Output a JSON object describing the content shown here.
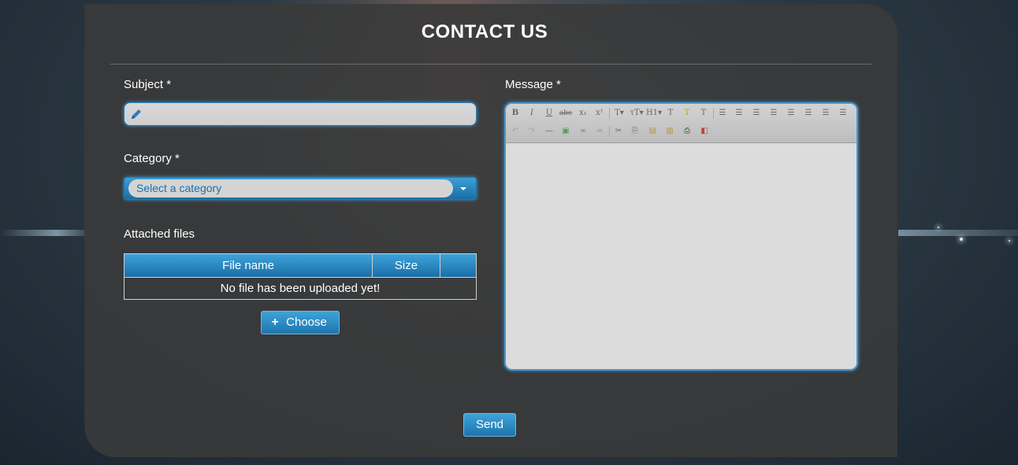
{
  "page": {
    "title": "CONTACT US"
  },
  "form": {
    "subject": {
      "label": "Subject *",
      "value": "",
      "icon": "pencil-icon"
    },
    "category": {
      "label": "Category *",
      "selected": "Select a category"
    },
    "attached_files": {
      "label": "Attached files",
      "columns": [
        "File name",
        "Size",
        ""
      ],
      "empty_message": "No file has been uploaded yet!",
      "choose_label": "Choose"
    },
    "message": {
      "label": "Message *",
      "value": ""
    },
    "send_label": "Send"
  },
  "toolbar": {
    "row1": [
      {
        "name": "bold-icon",
        "glyph": "B"
      },
      {
        "name": "italic-icon",
        "glyph": "I"
      },
      {
        "name": "underline-icon",
        "glyph": "U"
      },
      {
        "name": "strikethrough-icon",
        "glyph": "abc"
      },
      {
        "name": "subscript-icon",
        "glyph": "x₁"
      },
      {
        "name": "superscript-icon",
        "glyph": "x¹"
      },
      {
        "name": "font-family-icon",
        "glyph": "T▾"
      },
      {
        "name": "font-size-icon",
        "glyph": "τT▾"
      },
      {
        "name": "heading-icon",
        "glyph": "H1▾"
      },
      {
        "name": "text-color-icon",
        "glyph": "T"
      },
      {
        "name": "highlight-icon",
        "glyph": "T"
      },
      {
        "name": "remove-format-icon",
        "glyph": "T"
      },
      {
        "name": "bullet-list-icon",
        "glyph": "≡"
      },
      {
        "name": "numbered-list-icon",
        "glyph": "≡"
      },
      {
        "name": "outdent-icon",
        "glyph": "≡"
      },
      {
        "name": "indent-icon",
        "glyph": "≡"
      },
      {
        "name": "align-left-icon",
        "glyph": "≡"
      },
      {
        "name": "align-center-icon",
        "glyph": "≡"
      },
      {
        "name": "align-right-icon",
        "glyph": "≡"
      },
      {
        "name": "justify-icon",
        "glyph": "≡"
      }
    ],
    "row2": [
      {
        "name": "undo-icon",
        "glyph": "↶"
      },
      {
        "name": "redo-icon",
        "glyph": "↷"
      },
      {
        "name": "horizontal-rule-icon",
        "glyph": "—"
      },
      {
        "name": "image-icon",
        "glyph": "▣"
      },
      {
        "name": "link-icon",
        "glyph": "∞"
      },
      {
        "name": "unlink-icon",
        "glyph": "⇎"
      },
      {
        "name": "cut-icon",
        "glyph": "✂"
      },
      {
        "name": "copy-icon",
        "glyph": "⎘"
      },
      {
        "name": "paste-icon",
        "glyph": "▤"
      },
      {
        "name": "paste-text-icon",
        "glyph": "▥"
      },
      {
        "name": "print-icon",
        "glyph": "⎙"
      },
      {
        "name": "source-code-icon",
        "glyph": "◧"
      }
    ]
  }
}
